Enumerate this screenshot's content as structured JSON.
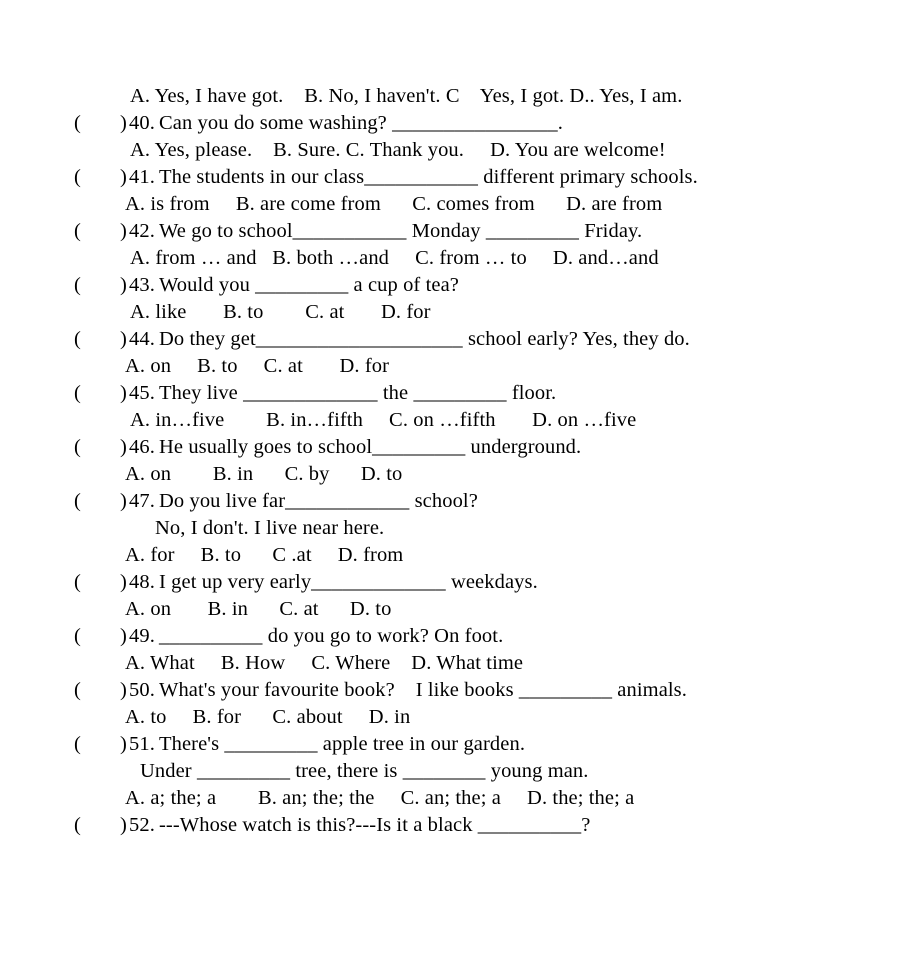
{
  "document": {
    "type": "english-grammar-multiple-choice-worksheet",
    "lines": [
      {
        "kind": "options",
        "indent": "a",
        "text": "A. Yes, I have got.    B. No, I haven't. C    Yes, I got. D.. Yes, I am."
      },
      {
        "kind": "question",
        "paren_open": "(",
        "paren_close": ")",
        "number": "40.",
        "text": "Can you do some washing? ________________."
      },
      {
        "kind": "options",
        "indent": "a",
        "text": "A. Yes, please.    B. Sure. C. Thank you.     D. You are welcome!"
      },
      {
        "kind": "question",
        "paren_open": "(",
        "paren_close": ")",
        "number": "41.",
        "text": "The students in our class___________ different primary schools."
      },
      {
        "kind": "options",
        "indent": "b",
        "text": "A. is from     B. are come from      C. comes from      D. are from"
      },
      {
        "kind": "question",
        "paren_open": "(",
        "paren_close": ")",
        "number": "42.",
        "text": "We go to school___________ Monday _________ Friday."
      },
      {
        "kind": "options",
        "indent": "a",
        "text": "A. from … and   B. both …and     C. from … to     D. and…and"
      },
      {
        "kind": "question",
        "paren_open": "(",
        "paren_close": ")",
        "number": "43.",
        "text": "Would you _________ a cup of tea?"
      },
      {
        "kind": "options",
        "indent": "a",
        "text": "A. like       B. to        C. at       D. for"
      },
      {
        "kind": "question",
        "paren_open": "(",
        "paren_close": ")",
        "number": "44.",
        "text": "Do they get____________________ school early? Yes, they do."
      },
      {
        "kind": "options",
        "indent": "b",
        "text": "A. on     B. to     C. at       D. for"
      },
      {
        "kind": "question",
        "paren_open": "(",
        "paren_close": ")",
        "number": "45.",
        "text": "They live _____________ the _________ floor."
      },
      {
        "kind": "options",
        "indent": "a",
        "text": "A. in…five        B. in…fifth     C. on …fifth       D. on …five"
      },
      {
        "kind": "question",
        "paren_open": "(",
        "paren_close": ")",
        "number": "46.",
        "text": "He usually goes to school_________ underground."
      },
      {
        "kind": "options",
        "indent": "b",
        "text": "A. on        B. in      C. by      D. to"
      },
      {
        "kind": "question",
        "paren_open": "(",
        "paren_close": ")",
        "number": "47.",
        "text": "Do you live far____________ school?"
      },
      {
        "kind": "options",
        "indent": "d",
        "text": "No, I don't. I live near here."
      },
      {
        "kind": "options",
        "indent": "b",
        "text": "A. for     B. to      C .at     D. from"
      },
      {
        "kind": "question",
        "paren_open": "(",
        "paren_close": ")",
        "number": "48.",
        "text": "I get up very early_____________ weekdays."
      },
      {
        "kind": "options",
        "indent": "b",
        "text": "A. on       B. in      C. at      D. to"
      },
      {
        "kind": "question",
        "paren_open": "(",
        "paren_close": ")",
        "number": "49.",
        "text": "__________ do you go to work? On foot."
      },
      {
        "kind": "options",
        "indent": "b",
        "text": "A. What     B. How     C. Where    D. What time"
      },
      {
        "kind": "question",
        "paren_open": "(",
        "paren_close": ")",
        "number": "50.",
        "text": "What's your favourite book?    I like books _________ animals."
      },
      {
        "kind": "options",
        "indent": "b",
        "text": "A. to     B. for      C. about     D. in"
      },
      {
        "kind": "question",
        "paren_open": "(",
        "paren_close": ")",
        "number": "51.",
        "text": "There's _________ apple tree in our garden."
      },
      {
        "kind": "options",
        "indent": "c",
        "text": "Under _________ tree, there is ________ young man."
      },
      {
        "kind": "options",
        "indent": "b",
        "text": "A. a; the; a        B. an; the; the     C. an; the; a     D. the; the; a"
      },
      {
        "kind": "question",
        "paren_open": "(",
        "paren_close": ")",
        "number": "52.",
        "text": "---Whose watch is this?---Is it a black __________?"
      }
    ]
  }
}
